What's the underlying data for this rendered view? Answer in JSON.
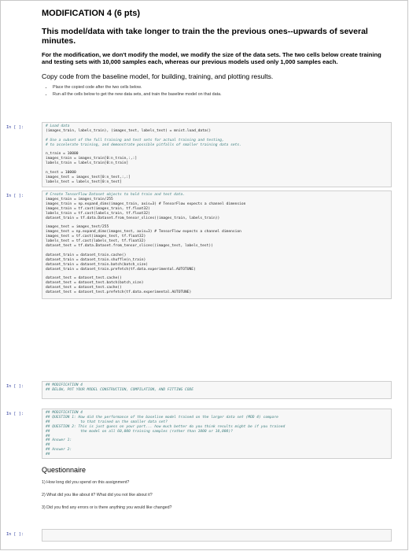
{
  "header": {
    "title": "MODIFICATION 4 (6 pts)",
    "subtitle": "This model/data with take longer to train the the previous ones--upwards of several minutes.",
    "paragraph": "For the modification, we don't modify the model, we modify the size of the data sets. The two cells below create training and testing sets with 10,000 samples each, whereas our previous models used only 1,000 samples each.",
    "instruction": "Copy code from the baseline model, for building, training, and plotting results.",
    "bullets": [
      "Place the copied code after the two cells below.",
      "Run all the cells below to get the new data sets, and train the baseline model on that data."
    ]
  },
  "prompts": [
    "In [ ]:",
    "In [ ]:",
    "In [ ]:",
    "In [ ]:",
    "In [ ]:"
  ],
  "cells": [
    {
      "lines": [
        "# Load data",
        "(images_train, labels_train), (images_test, labels_test) = mnist.load_data()",
        "",
        "# Use a subset of the full training and test sets for actual training and testing,",
        "# to accelerate training, and demonstrate possible pitfalls of smaller training data sets.",
        "",
        "n_train = 10000",
        "images_train = images_train[0:n_train,:,:]",
        "labels_train = labels_train[0:n_train]",
        "",
        "n_test = 10000",
        "images_test = images_test[0:n_test,:,:]",
        "labels_test = labels_test[0:n_test]"
      ]
    },
    {
      "lines": [
        "# Create TensorFlow Dataset objects to hold train and test data.",
        "images_train = images_train/255",
        "images_train = np.expand_dims(images_train, axis=3) # TensorFlow expects a channel dimension",
        "images_train = tf.cast(images_train, tf.float32)",
        "labels_train = tf.cast(labels_train, tf.float32)",
        "dataset_train = tf.data.Dataset.from_tensor_slices((images_train, labels_train))",
        "",
        "images_test = images_test/255",
        "images_test = np.expand_dims(images_test, axis=3) # TensorFlow expects a channel dimension",
        "images_test = tf.cast(images_test, tf.float32)",
        "labels_test = tf.cast(labels_test, tf.float32)",
        "dataset_test = tf.data.Dataset.from_tensor_slices((images_test, labels_test))",
        "",
        "dataset_train = dataset_train.cache()",
        "dataset_train = dataset_train.shuffle(n_train)",
        "dataset_train = dataset_train.batch(batch_size)",
        "dataset_train = dataset_train.prefetch(tf.data.experimental.AUTOTUNE)",
        "",
        "dataset_test = dataset_test.cache()",
        "dataset_test = dataset_test.batch(batch_size)",
        "dataset_test = dataset_test.cache()",
        "dataset_test = dataset_test.prefetch(tf.data.experimental.AUTOTUNE)"
      ]
    },
    {
      "lines": [
        "## MODIFICATION 4",
        "## BELOW, PUT YOUR MODEL CONSTRUCTION, COMPILATION, AND FITTING CODE"
      ]
    },
    {
      "lines": [
        "## MODIFICATION 4",
        "## QUESTION 1: How did the performance of the baseline model trained on the larger data set (MOD 4) compare",
        "##              to that trained on the smaller data set?",
        "## QUESTION 2: This is just guess on your part... how much better do you think results might be if you trained",
        "##              the model on all 60,000 training samples (rather than 1000 or 10,000)?",
        "##",
        "## Answer 1:",
        "##",
        "## Answer 2:",
        "##"
      ]
    }
  ],
  "questionnaire": {
    "title": "Questionnaire",
    "questions": [
      "1) How long did you spend on this assignment?",
      "2) What did you like about it? What did you not like about it?",
      "3) Did you find any errors or is there anything you would like changed?"
    ]
  }
}
